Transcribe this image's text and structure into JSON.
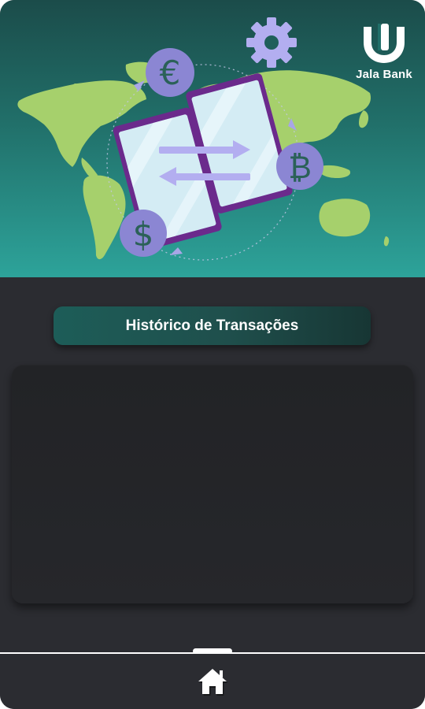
{
  "brand": {
    "name": "Jala Bank",
    "logo_icon": "jala-bank-logo"
  },
  "hero": {
    "illustration": "world-map-money-transfer",
    "icons": [
      "gear-icon",
      "euro-icon",
      "bitcoin-icon",
      "dollar-icon",
      "transfer-arrows-icon"
    ]
  },
  "main": {
    "title": "Histórico de Transações"
  },
  "nav": {
    "home_icon": "home-icon"
  },
  "colors": {
    "background": "#2b2c31",
    "accent": "#1f5f5a",
    "hero_top": "#1b4c4a",
    "hero_bottom": "#2da39a",
    "map": "#a3cd6b",
    "purple": "#8b8ad6",
    "text": "#ffffff"
  }
}
